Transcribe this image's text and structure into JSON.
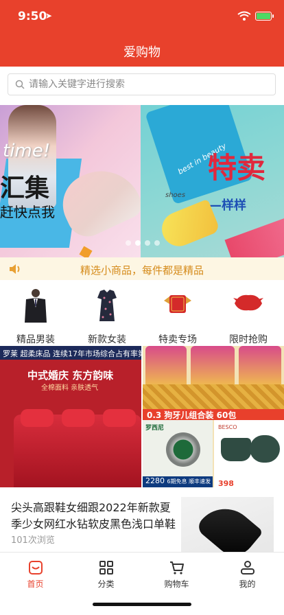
{
  "status_bar": {
    "time": "9:50",
    "location_arrow": "location-arrow-icon",
    "battery_state": "charging"
  },
  "header": {
    "title": "爱购物"
  },
  "search": {
    "placeholder": "请输入关键字进行搜索"
  },
  "banner": {
    "slides": [
      {
        "script_text": "time!",
        "headline": "汇集",
        "subline": "赶快点我"
      },
      {
        "script_text": "best in beauty",
        "small_text": "shoes",
        "headline": "特卖",
        "subline": "—样样"
      }
    ],
    "active_dot": 1,
    "dot_count": 4
  },
  "notice": {
    "icon": "speaker-icon",
    "text": "精选小商品，每件都是精品"
  },
  "categories": [
    {
      "label": "精品男装",
      "icon": "mens-suit-image"
    },
    {
      "label": "新款女装",
      "icon": "womens-dress-image"
    },
    {
      "label": "特卖专场",
      "icon": "sale-badge-image"
    },
    {
      "label": "限时抢购",
      "icon": "flash-sale-badge-image"
    }
  ],
  "promos": [
    {
      "brand": "罗莱",
      "brand_sub": "超柔床品",
      "top_note": "连续17年市场综合占有率第一",
      "headline": "中式婚庆 东方韵味",
      "subline": "全棉面料 亲肤透气"
    },
    {
      "band_text": "0.3 狗牙儿组合装 60包",
      "watch_brand": "罗西尼",
      "watch_price": "2280",
      "watch_note": "6期免息 顺丰速发",
      "pot_brand": "BESCO",
      "pot_price": "398"
    }
  ],
  "product": {
    "name": "尖头高跟鞋女细跟2022年新款夏季少女网红水钻软皮黑色浅口单鞋",
    "views": "101次浏览"
  },
  "tabbar": {
    "active": 0,
    "items": [
      {
        "label": "首页",
        "icon": "home-icon"
      },
      {
        "label": "分类",
        "icon": "grid-icon"
      },
      {
        "label": "购物车",
        "icon": "cart-icon"
      },
      {
        "label": "我的",
        "icon": "user-icon"
      }
    ]
  },
  "colors": {
    "brand": "#e8412c",
    "notice_text": "#d58b1b",
    "notice_bg": "#fdf6e3"
  }
}
